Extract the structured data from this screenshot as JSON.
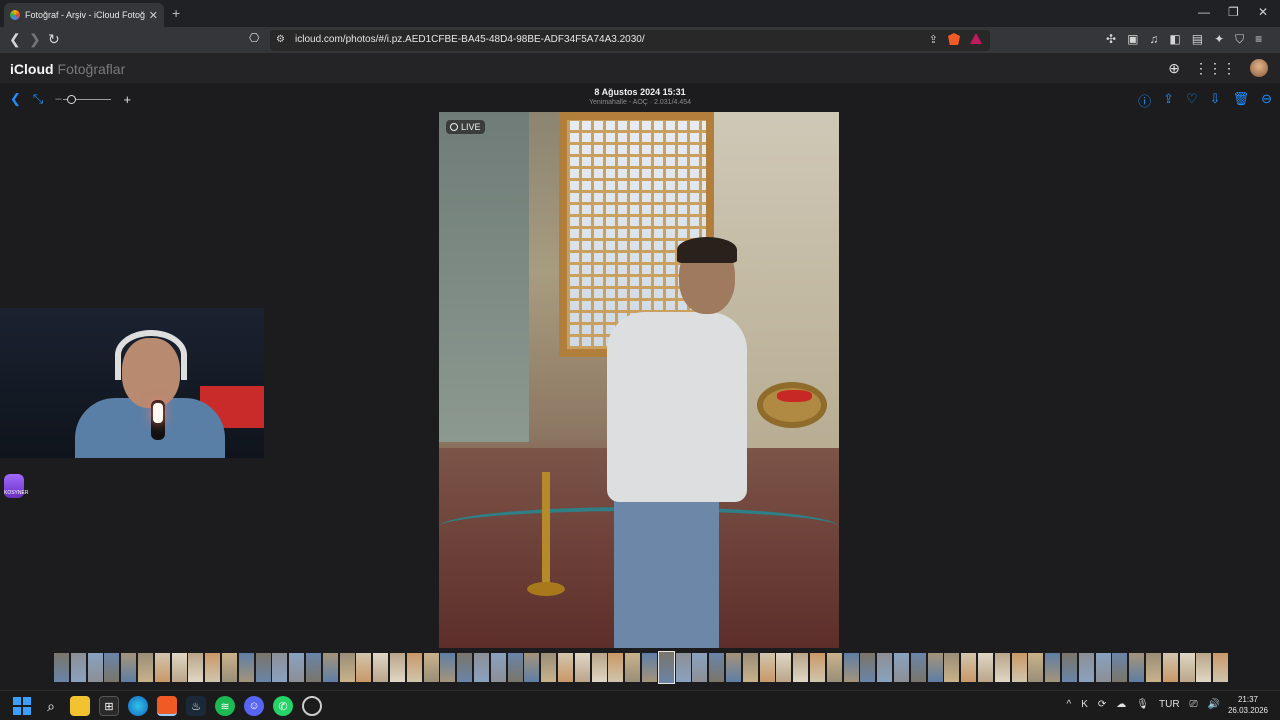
{
  "browser": {
    "tab_title": "Fotoğraf - Arşiv - iCloud Fotoğr...",
    "tab_close": "✕",
    "new_tab": "+",
    "url": "icloud.com/photos/#/i.pz.AED1CFBE-BA45-48D4-98BE-ADF34F5A74A3.2030/",
    "window_controls": [
      "—",
      "❐",
      "✕"
    ]
  },
  "app": {
    "brand_name": "iCloud",
    "section_name": "Fotoğraflar"
  },
  "viewer": {
    "date": "8 Ağustos 2024 15:31",
    "subtitle": "Yenimahalle - AOÇ · 2.031/4.454",
    "live_label": "LIVE",
    "zoom_plus": "+",
    "zoom_minus": "–"
  },
  "streamer_logo_text": "KOSYNER",
  "taskbar": {
    "lang": "TUR",
    "time": "21:37",
    "date": "26.03.2026"
  },
  "icons": {
    "nav": [
      "back-icon",
      "forward-icon",
      "reload-icon",
      "bookmark-icon",
      "site-info-icon"
    ],
    "url_right": [
      "share-icon",
      "brave-shield-icon",
      "brave-rewards-icon"
    ],
    "extensions": [
      "extensions-icon",
      "tab-manager-icon",
      "media-icon",
      "sidebar-icon",
      "wallet-icon",
      "leo-icon",
      "vpn-icon",
      "menu-icon"
    ],
    "viewer_right": [
      "info-icon",
      "share-icon",
      "favorite-icon",
      "download-icon",
      "trash-icon",
      "more-icon"
    ]
  },
  "colors": {
    "accent": "#1f8fff",
    "background": "#1c1c1e"
  }
}
